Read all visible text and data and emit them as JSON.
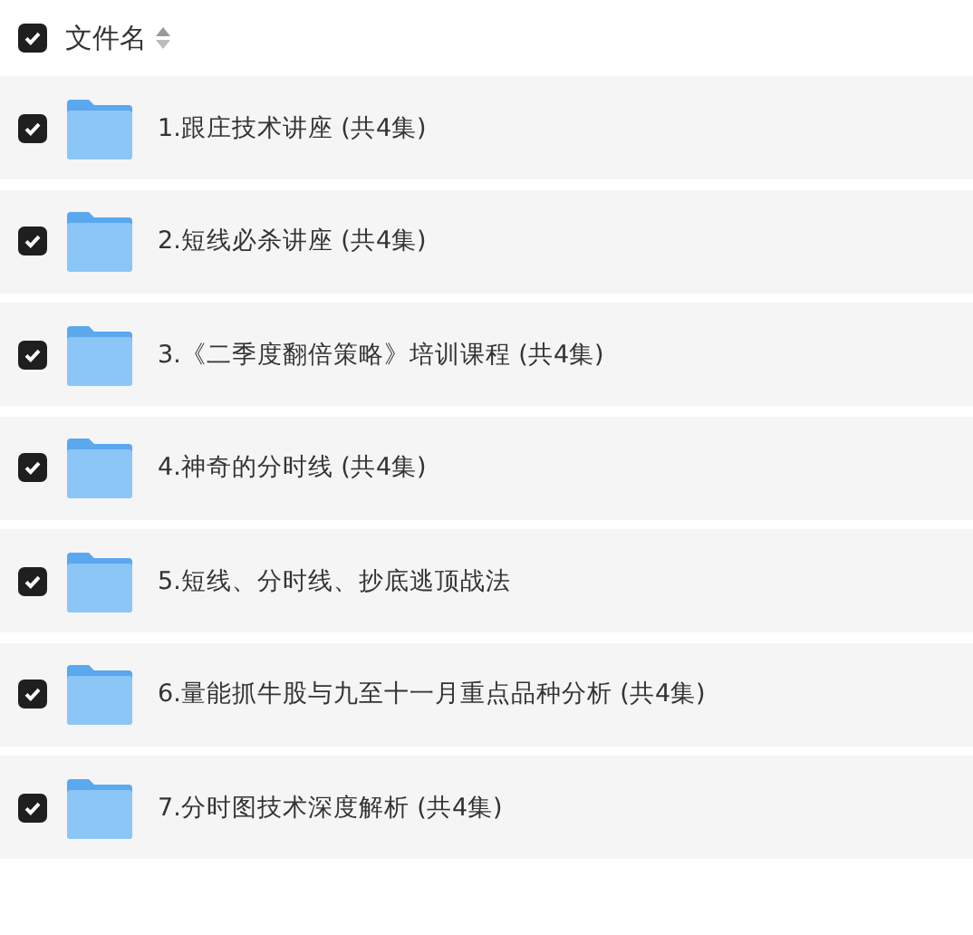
{
  "header": {
    "checked": true,
    "label": "文件名"
  },
  "files": [
    {
      "name": "1.跟庄技术讲座 (共4集)",
      "checked": true
    },
    {
      "name": "2.短线必杀讲座 (共4集)",
      "checked": true
    },
    {
      "name": "3.《二季度翻倍策略》培训课程 (共4集)",
      "checked": true
    },
    {
      "name": "4.神奇的分时线 (共4集)",
      "checked": true
    },
    {
      "name": "5.短线、分时线、抄底逃顶战法",
      "checked": true
    },
    {
      "name": "6.量能抓牛股与九至十一月重点品种分析 (共4集)",
      "checked": true
    },
    {
      "name": "7.分时图技术深度解析 (共4集)",
      "checked": true
    }
  ]
}
